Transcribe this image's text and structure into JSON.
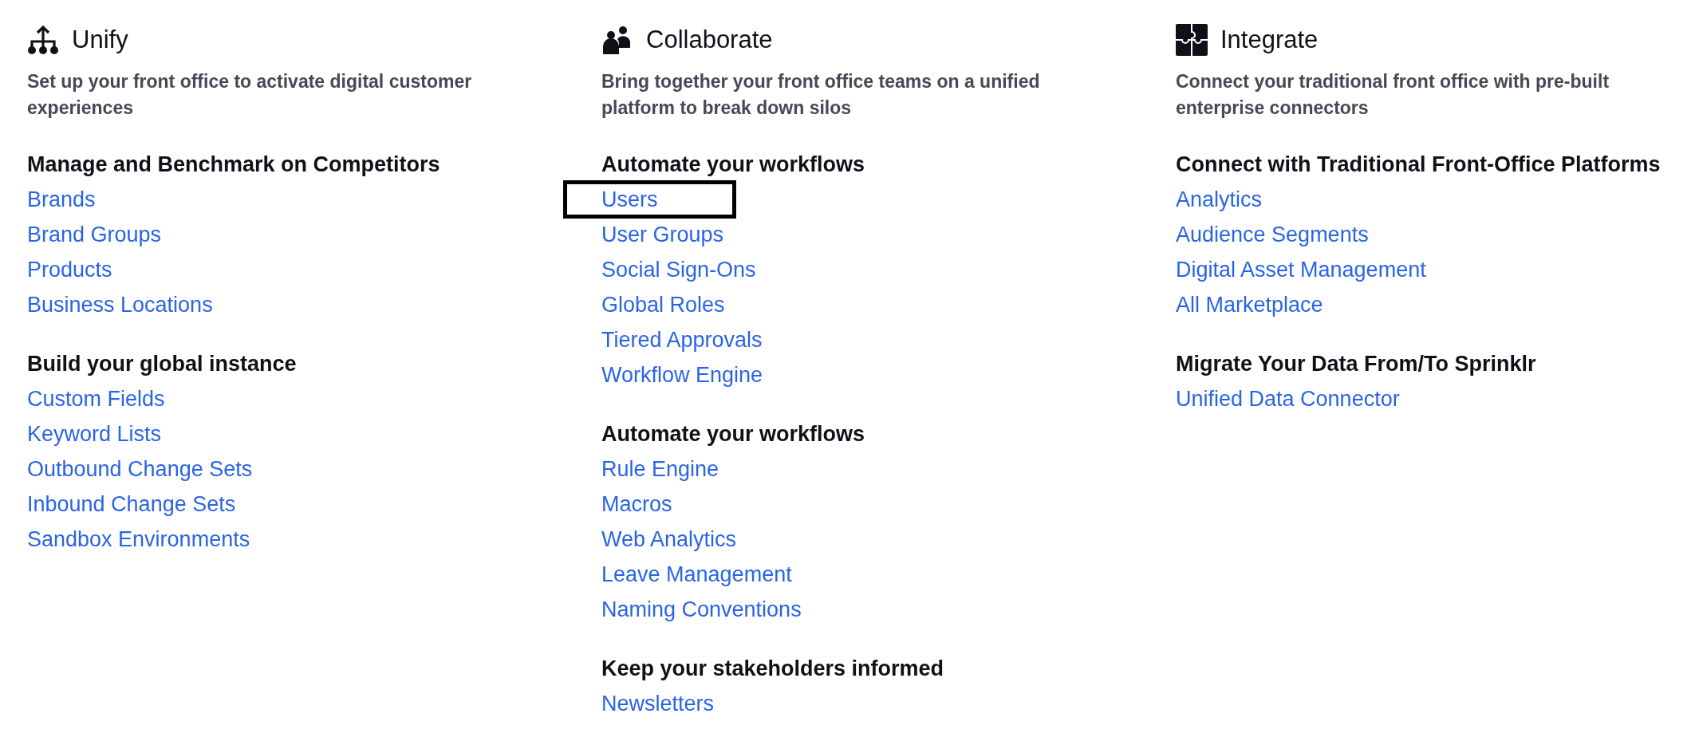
{
  "columns": [
    {
      "title": "Unify",
      "description": "Set up your front office to activate digital customer experiences",
      "groups": [
        {
          "heading": "Manage and Benchmark on Competitors",
          "links": [
            {
              "label": "Brands",
              "highlighted": false
            },
            {
              "label": "Brand Groups",
              "highlighted": false
            },
            {
              "label": "Products",
              "highlighted": false
            },
            {
              "label": "Business Locations",
              "highlighted": false
            }
          ]
        },
        {
          "heading": "Build your global instance",
          "links": [
            {
              "label": "Custom Fields",
              "highlighted": false
            },
            {
              "label": "Keyword Lists",
              "highlighted": false
            },
            {
              "label": "Outbound Change Sets",
              "highlighted": false
            },
            {
              "label": "Inbound Change Sets",
              "highlighted": false
            },
            {
              "label": "Sandbox Environments",
              "highlighted": false
            }
          ]
        }
      ]
    },
    {
      "title": "Collaborate",
      "description": "Bring together your front office teams on a unified platform to break down silos",
      "groups": [
        {
          "heading": "Automate your workflows",
          "links": [
            {
              "label": "Users",
              "highlighted": true
            },
            {
              "label": "User Groups",
              "highlighted": false
            },
            {
              "label": "Social Sign-Ons",
              "highlighted": false
            },
            {
              "label": "Global Roles",
              "highlighted": false
            },
            {
              "label": "Tiered Approvals",
              "highlighted": false
            },
            {
              "label": "Workflow Engine",
              "highlighted": false
            }
          ]
        },
        {
          "heading": "Automate your workflows",
          "links": [
            {
              "label": "Rule Engine",
              "highlighted": false
            },
            {
              "label": "Macros",
              "highlighted": false
            },
            {
              "label": "Web Analytics",
              "highlighted": false
            },
            {
              "label": "Leave Management",
              "highlighted": false
            },
            {
              "label": "Naming Conventions",
              "highlighted": false
            }
          ]
        },
        {
          "heading": "Keep your stakeholders informed",
          "links": [
            {
              "label": "Newsletters",
              "highlighted": false
            }
          ]
        }
      ]
    },
    {
      "title": "Integrate",
      "description": "Connect your traditional front office with pre-built enterprise connectors",
      "groups": [
        {
          "heading": "Connect with Traditional Front-Office Platforms",
          "links": [
            {
              "label": "Analytics",
              "highlighted": false
            },
            {
              "label": "Audience Segments",
              "highlighted": false
            },
            {
              "label": "Digital Asset Management",
              "highlighted": false
            },
            {
              "label": "All Marketplace",
              "highlighted": false
            }
          ]
        },
        {
          "heading": "Migrate Your Data From/To Sprinklr",
          "links": [
            {
              "label": "Unified Data Connector",
              "highlighted": false
            }
          ]
        }
      ]
    }
  ]
}
